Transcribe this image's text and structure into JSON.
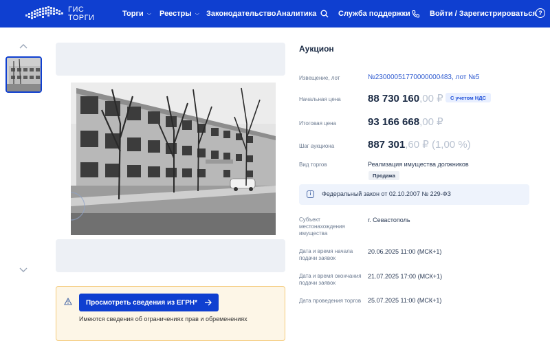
{
  "header": {
    "logo_line1": "ГИС",
    "logo_line2": "ТОРГИ",
    "nav": {
      "torgi": "Торги",
      "reestry": "Реестры",
      "zakonodatelstvo": "Законодательство",
      "analitika": "Аналитика",
      "support": "Служба поддержки",
      "login": "Войти / Зарегистрироваться"
    },
    "icons": {
      "search": "search-icon",
      "phone": "phone-icon",
      "help": "help-icon",
      "chevron": "chevron-down-icon"
    }
  },
  "gallery": {
    "icons": {
      "up": "chevron-up-icon",
      "down": "chevron-down-icon"
    }
  },
  "notice": {
    "button_label": "Просмотреть сведения из ЕГРН*",
    "text": "Имеются сведения об ограничениях прав и обременениях",
    "icons": {
      "warning": "warning-icon",
      "arrow": "arrow-right-icon"
    }
  },
  "details": {
    "title": "Аукцион",
    "notice_label": "Извещение, лот",
    "notice_value": "№23000051770000000483, лот №5",
    "start_price_label": "Начальная цена",
    "start_price_int": "88 730 160",
    "start_price_dec": ",00 ₽",
    "vat_badge": "С учетом НДС",
    "final_price_label": "Итоговая цена",
    "final_price_int": "93 166 668",
    "final_price_dec": ",00 ₽",
    "step_label": "Шаг аукциона",
    "step_int": "887 301",
    "step_dec": ",60 ₽ (1,00 %)",
    "type_label": "Вид торгов",
    "type_value": "Реализация имущества должников",
    "sale_badge": "Продажа",
    "law_text": "Федеральный закон от 02.10.2007 № 229-ФЗ",
    "location_label_1": "Субъект",
    "location_label_2": "местонахождения",
    "location_label_3": "имущества",
    "location_value": "г. Севастополь",
    "start_date_label_1": "Дата и время начала",
    "start_date_label_2": "подачи заявок",
    "start_date_value": "20.06.2025 11:00 (МСК+1)",
    "end_date_label_1": "Дата и время окончания",
    "end_date_label_2": "подачи заявок",
    "end_date_value": "21.07.2025 17:00 (МСК+1)",
    "auction_date_label": "Дата проведения торгов",
    "auction_date_value": "25.07.2025 11:00 (МСК+1)"
  },
  "colors": {
    "header_bg": "#0f3fd0",
    "link": "#2f5bd0",
    "notice_bg": "#fdf6e7",
    "notice_border": "#f4c978",
    "law_bg": "#eef3fc"
  }
}
